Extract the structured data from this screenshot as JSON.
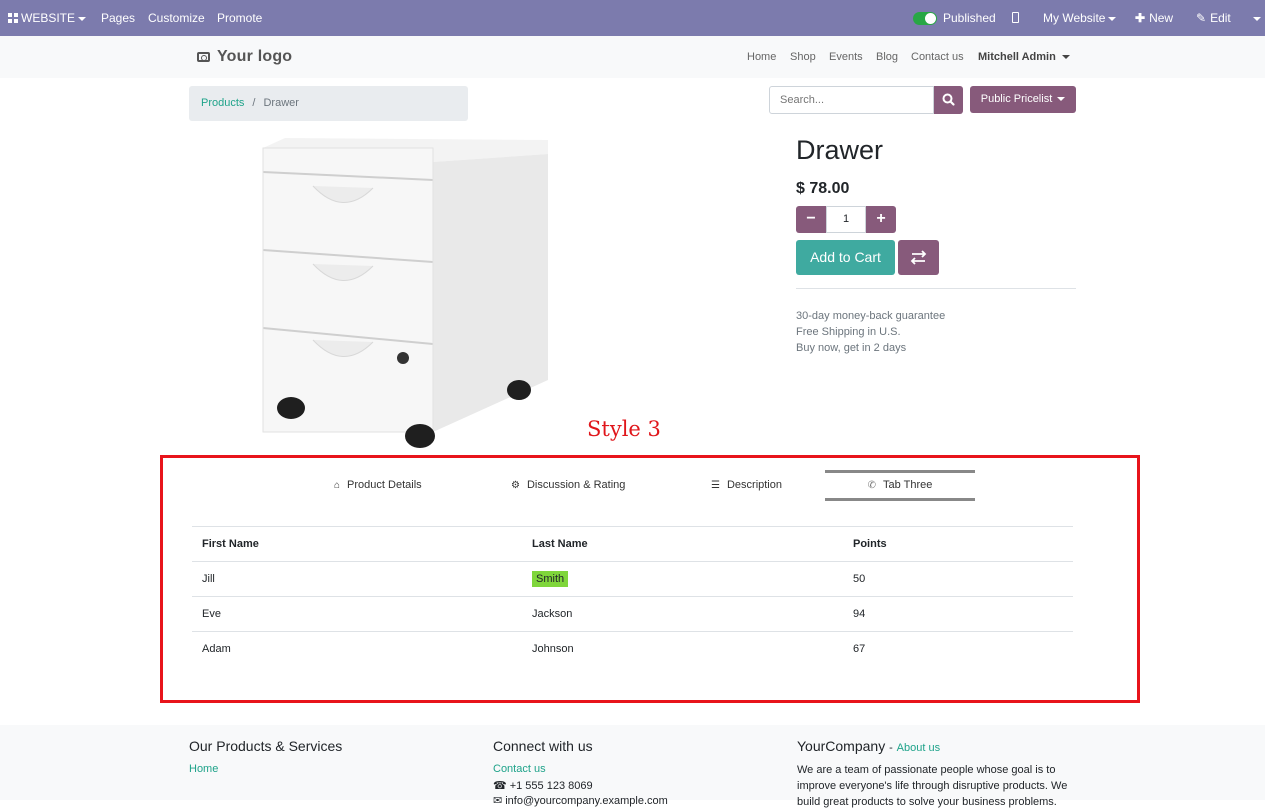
{
  "adminbar": {
    "website": "WEBSITE",
    "pages": "Pages",
    "customize": "Customize",
    "promote": "Promote",
    "published": "Published",
    "my_website": "My Website",
    "new": "New",
    "edit": "Edit"
  },
  "header": {
    "logo": "Your logo",
    "menu": [
      "Home",
      "Shop",
      "Events",
      "Blog",
      "Contact us"
    ],
    "user": "Mitchell Admin"
  },
  "breadcrumb": {
    "products": "Products",
    "separator": "/",
    "current": "Drawer"
  },
  "search": {
    "placeholder": "Search..."
  },
  "pricelist": "Public Pricelist",
  "product": {
    "name": "Drawer",
    "price": "$ 78.00",
    "quantity": "1",
    "add_to_cart": "Add to Cart",
    "perks": [
      "30-day money-back guarantee",
      "Free Shipping in U.S.",
      "Buy now, get in 2 days"
    ]
  },
  "annotation": {
    "label": "Style 3",
    "color": "#e8141b"
  },
  "tabs": [
    {
      "label": "Product Details",
      "icon": "home-icon"
    },
    {
      "label": "Discussion & Rating",
      "icon": "gear-icon"
    },
    {
      "label": "Description",
      "icon": "list-icon"
    },
    {
      "label": "Tab Three",
      "icon": "phone-icon",
      "active": true
    }
  ],
  "table": {
    "headers": [
      "First Name",
      "Last Name",
      "Points"
    ],
    "rows": [
      [
        "Jill",
        "Smith",
        "50"
      ],
      [
        "Eve",
        "Jackson",
        "94"
      ],
      [
        "Adam",
        "Johnson",
        "67"
      ]
    ],
    "highlighted_cell": "Smith"
  },
  "footer": {
    "col1": {
      "title": "Our Products & Services",
      "link": "Home"
    },
    "col2": {
      "title": "Connect with us",
      "link": "Contact us",
      "phone": "+1 555 123 8069",
      "email": "info@yourcompany.example.com"
    },
    "col3": {
      "title": "YourCompany",
      "dash": "-",
      "about": "About us",
      "text": [
        "We are a team of passionate people whose goal is to",
        "improve everyone's life through disruptive products. We",
        "build great products to solve your business problems."
      ]
    }
  },
  "colors": {
    "adminbar": "#7c7bad",
    "primary": "#875a7b",
    "cart": "#3faaa0",
    "link": "#1fa38a",
    "highlight": "#7fd63b"
  }
}
